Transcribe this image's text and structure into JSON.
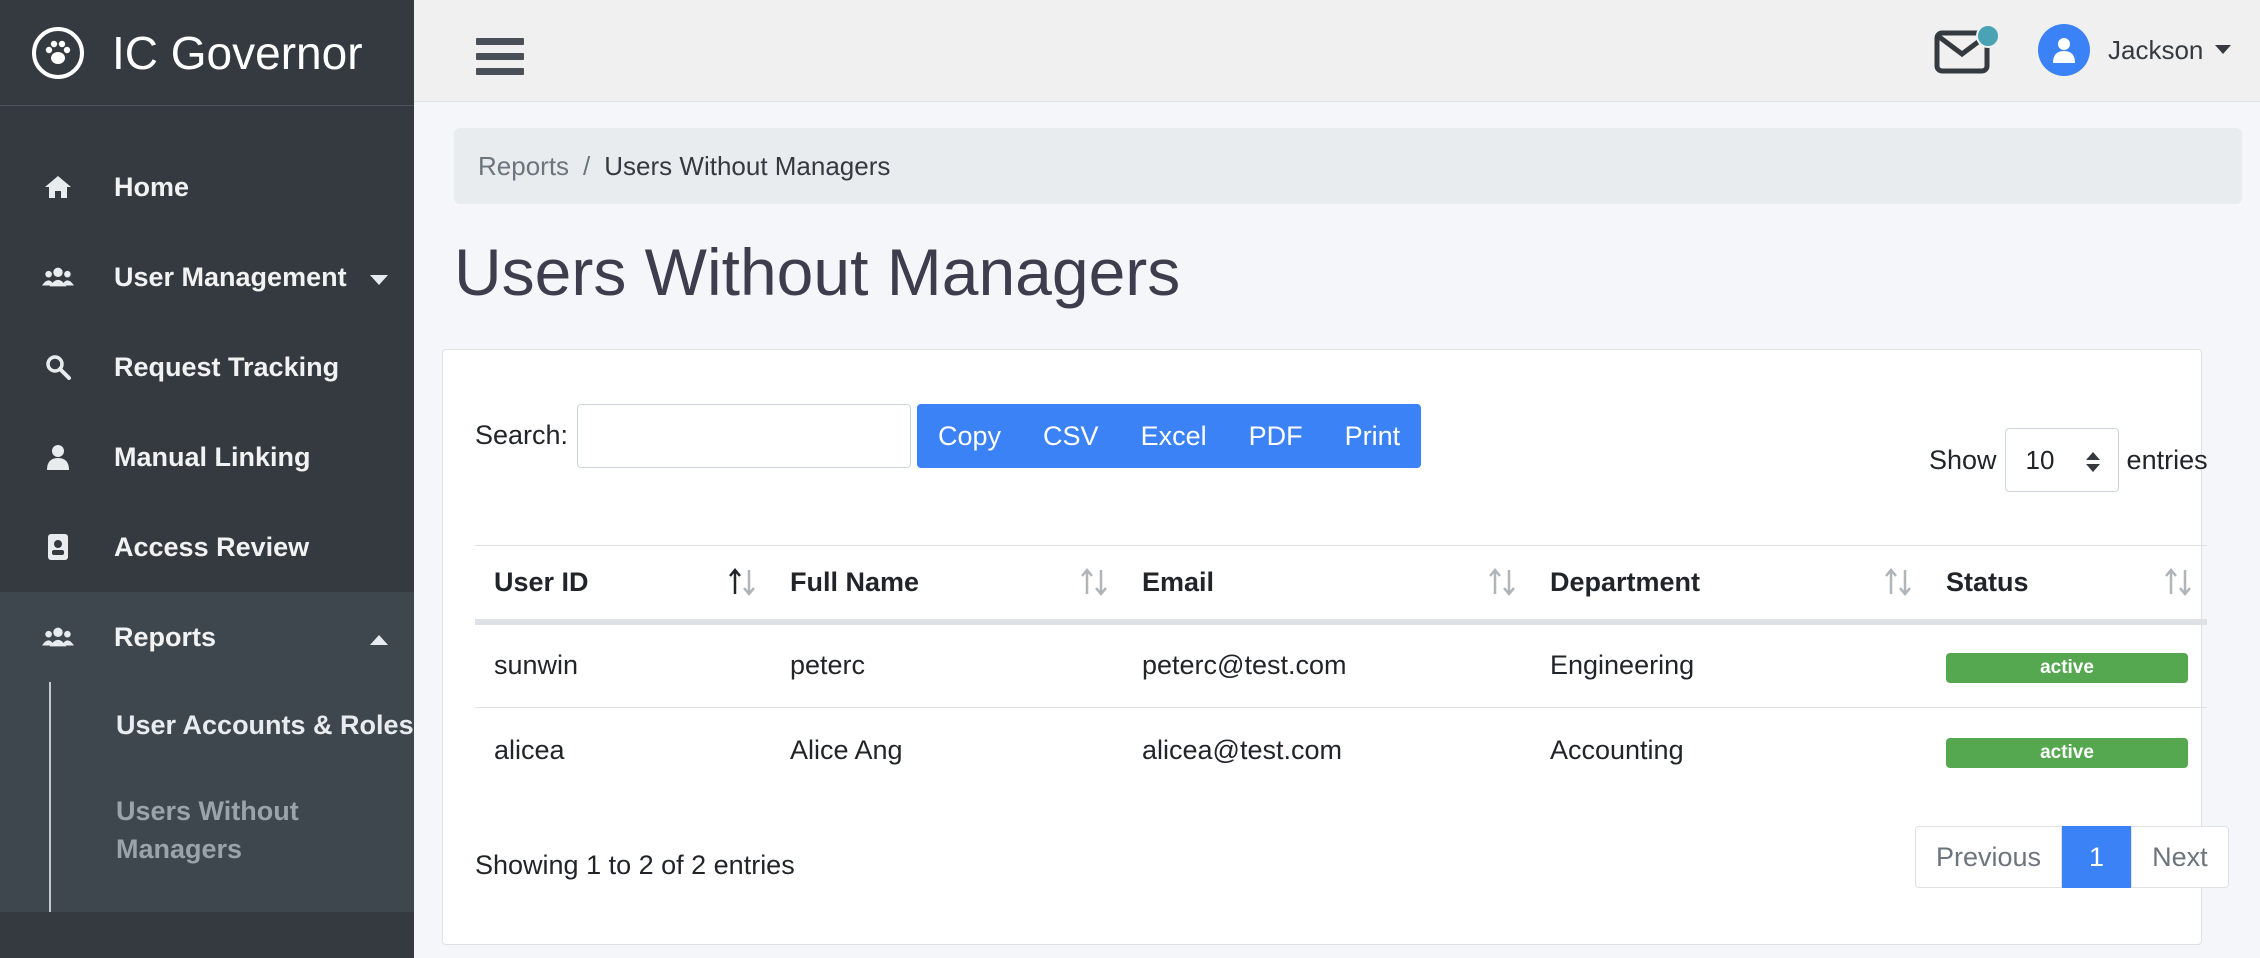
{
  "app": {
    "title": "IC Governor",
    "logo_icon": "paw-icon"
  },
  "sidebar": {
    "items": [
      {
        "label": "Home",
        "icon": "home-icon"
      },
      {
        "label": "User Management",
        "icon": "users-icon",
        "has_caret": true
      },
      {
        "label": "Request Tracking",
        "icon": "search-icon"
      },
      {
        "label": "Manual Linking",
        "icon": "user-icon"
      },
      {
        "label": "Access Review",
        "icon": "id-badge-icon"
      },
      {
        "label": "Reports",
        "icon": "users-icon",
        "expanded": true
      }
    ],
    "reports_sub": [
      {
        "label": "User Accounts & Roles"
      },
      {
        "label": "Users Without Managers",
        "active": true
      }
    ]
  },
  "topbar": {
    "user_name": "Jackson",
    "mail_icon": "envelope-icon"
  },
  "breadcrumb": {
    "parent": "Reports",
    "separator": "/",
    "current": "Users Without Managers"
  },
  "page": {
    "title": "Users Without Managers"
  },
  "table_controls": {
    "search_label": "Search:",
    "search_value": "",
    "buttons": [
      "Copy",
      "CSV",
      "Excel",
      "PDF",
      "Print"
    ],
    "show_label": "Show",
    "show_value": "10",
    "entries_label": "entries"
  },
  "table": {
    "columns": [
      "User ID",
      "Full Name",
      "Email",
      "Department",
      "Status"
    ],
    "rows": [
      [
        "sunwin",
        "peterc",
        "peterc@test.com",
        "Engineering",
        "active"
      ],
      [
        "alicea",
        "Alice Ang",
        "alicea@test.com",
        "Accounting",
        "active"
      ]
    ]
  },
  "footer": {
    "info": "Showing 1 to 2 of 2 entries",
    "prev": "Previous",
    "page": "1",
    "next": "Next"
  },
  "colors": {
    "sidebar": "#343a40",
    "primary": "#3b82f6",
    "success": "#55a84f",
    "notify": "#4aa3b5"
  }
}
